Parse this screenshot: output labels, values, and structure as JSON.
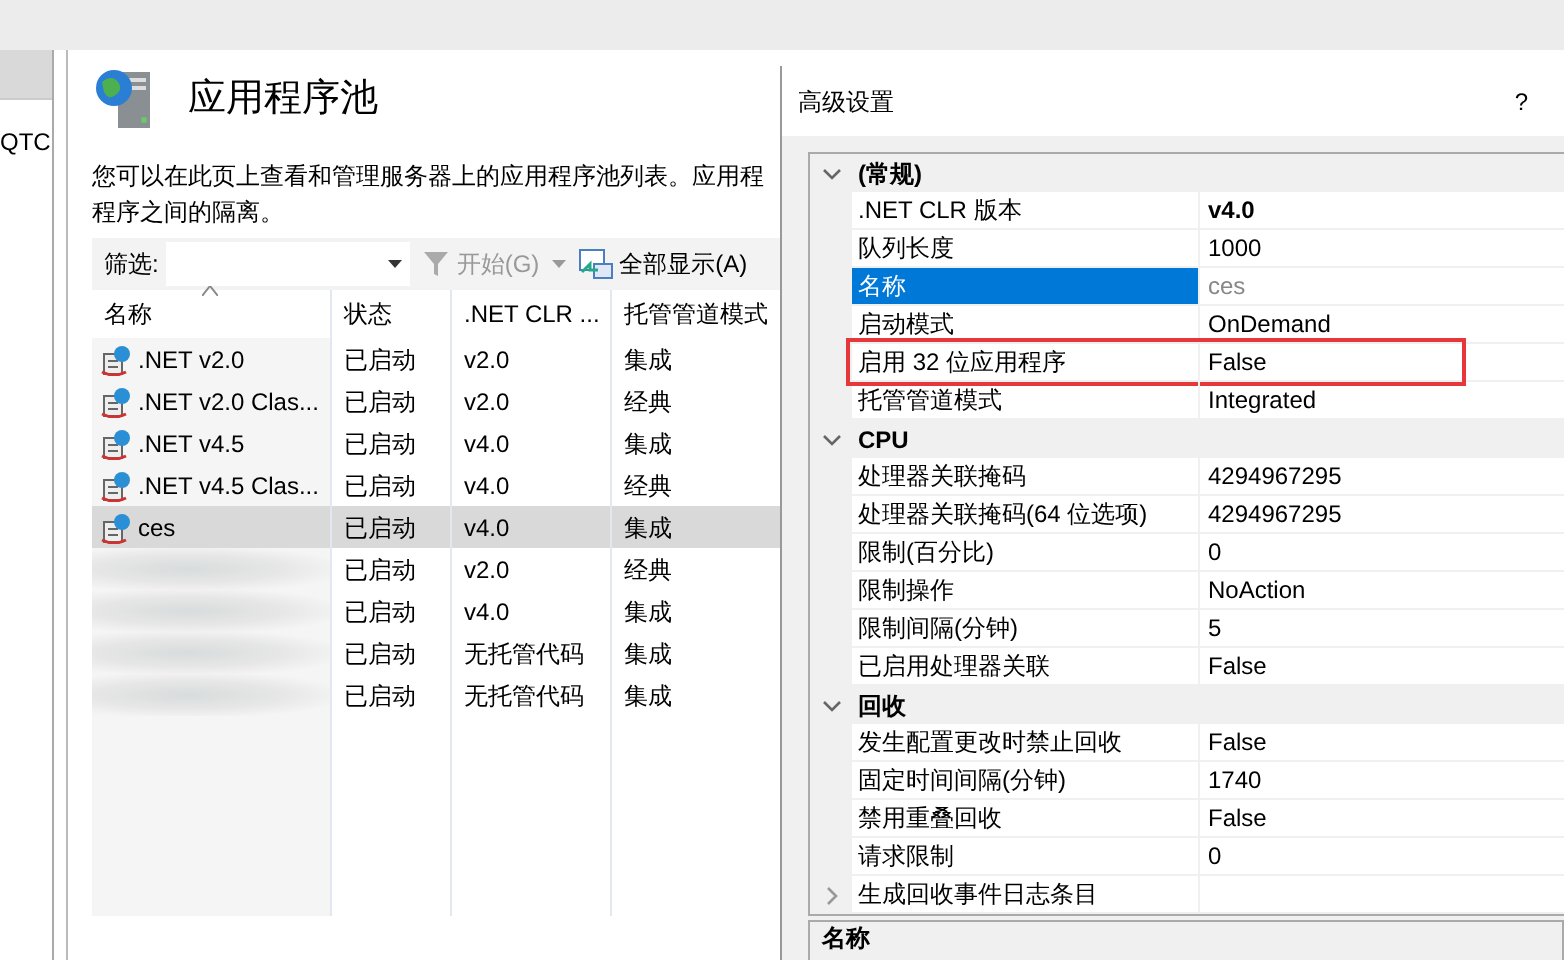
{
  "left_pane": {
    "text": "QTC"
  },
  "page": {
    "title": "应用程序池",
    "description_lines": [
      "您可以在此页上查看和管理服务器上的应用程序池列表。应用程",
      "程序之间的隔离。"
    ]
  },
  "toolbar": {
    "filter_label": "筛选:",
    "start_button": {
      "label": "开始(G)",
      "disabled": true
    },
    "show_all_button": {
      "label": "全部显示(A)",
      "disabled": false
    }
  },
  "table": {
    "columns": [
      {
        "label": "名称",
        "sorted": true
      },
      {
        "label": "状态",
        "sorted": false
      },
      {
        "label": ".NET CLR ...",
        "sorted": false
      },
      {
        "label": "托管管道模式",
        "sorted": false
      }
    ],
    "rows": [
      {
        "name": ".NET v2.0",
        "status": "已启动",
        "clr": "v2.0",
        "pipeline": "集成",
        "selected": false
      },
      {
        "name": ".NET v2.0 Clas...",
        "status": "已启动",
        "clr": "v2.0",
        "pipeline": "经典",
        "selected": false
      },
      {
        "name": ".NET v4.5",
        "status": "已启动",
        "clr": "v4.0",
        "pipeline": "集成",
        "selected": false
      },
      {
        "name": ".NET v4.5 Clas...",
        "status": "已启动",
        "clr": "v4.0",
        "pipeline": "经典",
        "selected": false
      },
      {
        "name": "ces",
        "status": "已启动",
        "clr": "v4.0",
        "pipeline": "集成",
        "selected": true
      },
      {
        "status": "已启动",
        "clr": "v2.0",
        "pipeline": "经典",
        "selected": false
      },
      {
        "status": "已启动",
        "clr": "v4.0",
        "pipeline": "集成",
        "selected": false
      },
      {
        "status": "已启动",
        "clr": "无托管代码",
        "pipeline": "集成",
        "selected": false
      },
      {
        "status": "已启动",
        "clr": "无托管代码",
        "pipeline": "集成",
        "selected": false
      }
    ]
  },
  "dialog": {
    "title": "高级设置",
    "help": "?",
    "groups": [
      {
        "label": "(常规)",
        "expanded": true,
        "properties": [
          {
            "label": ".NET CLR 版本",
            "value": "v4.0",
            "selected": false,
            "modified": true
          },
          {
            "label": "队列长度",
            "value": "1000",
            "selected": false
          },
          {
            "label": "名称",
            "value": "ces",
            "selected": true,
            "read_only": true
          },
          {
            "label": "启动模式",
            "value": "OnDemand",
            "selected": false
          },
          {
            "label": "启用 32 位应用程序",
            "value": "False",
            "selected": false,
            "highlighted": true
          },
          {
            "label": "托管管道模式",
            "value": "Integrated",
            "selected": false
          }
        ]
      },
      {
        "label": "CPU",
        "expanded": true,
        "properties": [
          {
            "label": "处理器关联掩码",
            "value": "4294967295",
            "selected": false
          },
          {
            "label": "处理器关联掩码(64 位选项)",
            "value": "4294967295",
            "selected": false
          },
          {
            "label": "限制(百分比)",
            "value": "0",
            "selected": false
          },
          {
            "label": "限制操作",
            "value": "NoAction",
            "selected": false
          },
          {
            "label": "限制间隔(分钟)",
            "value": "5",
            "selected": false
          },
          {
            "label": "已启用处理器关联",
            "value": "False",
            "selected": false
          }
        ]
      },
      {
        "label": "回收",
        "expanded": true,
        "properties": [
          {
            "label": "发生配置更改时禁止回收",
            "value": "False",
            "selected": false
          },
          {
            "label": "固定时间间隔(分钟)",
            "value": "1740",
            "selected": false
          },
          {
            "label": "禁用重叠回收",
            "value": "False",
            "selected": false
          },
          {
            "label": "请求限制",
            "value": "0",
            "selected": false
          },
          {
            "label": "生成回收事件日志条目",
            "selected": false,
            "expanded": false
          }
        ]
      }
    ],
    "description_title": "名称"
  }
}
